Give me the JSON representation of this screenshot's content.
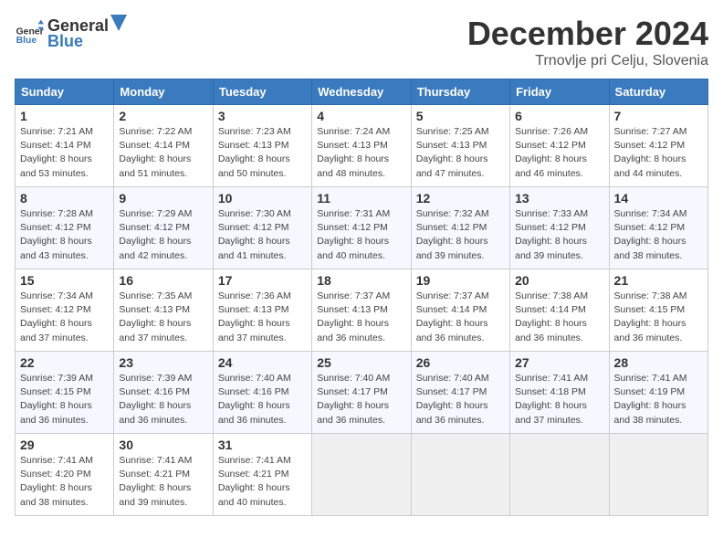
{
  "header": {
    "logo_general": "General",
    "logo_blue": "Blue",
    "month_title": "December 2024",
    "location": "Trnovlje pri Celju, Slovenia"
  },
  "calendar": {
    "days_of_week": [
      "Sunday",
      "Monday",
      "Tuesday",
      "Wednesday",
      "Thursday",
      "Friday",
      "Saturday"
    ],
    "weeks": [
      [
        null,
        {
          "day": "2",
          "sunrise": "7:22 AM",
          "sunset": "4:14 PM",
          "daylight": "8 hours and 51 minutes."
        },
        {
          "day": "3",
          "sunrise": "7:23 AM",
          "sunset": "4:13 PM",
          "daylight": "8 hours and 50 minutes."
        },
        {
          "day": "4",
          "sunrise": "7:24 AM",
          "sunset": "4:13 PM",
          "daylight": "8 hours and 48 minutes."
        },
        {
          "day": "5",
          "sunrise": "7:25 AM",
          "sunset": "4:13 PM",
          "daylight": "8 hours and 47 minutes."
        },
        {
          "day": "6",
          "sunrise": "7:26 AM",
          "sunset": "4:12 PM",
          "daylight": "8 hours and 46 minutes."
        },
        {
          "day": "7",
          "sunrise": "7:27 AM",
          "sunset": "4:12 PM",
          "daylight": "8 hours and 44 minutes."
        }
      ],
      [
        {
          "day": "1",
          "sunrise": "7:21 AM",
          "sunset": "4:14 PM",
          "daylight": "8 hours and 53 minutes."
        },
        {
          "day": "9",
          "sunrise": "7:29 AM",
          "sunset": "4:12 PM",
          "daylight": "8 hours and 42 minutes."
        },
        {
          "day": "10",
          "sunrise": "7:30 AM",
          "sunset": "4:12 PM",
          "daylight": "8 hours and 41 minutes."
        },
        {
          "day": "11",
          "sunrise": "7:31 AM",
          "sunset": "4:12 PM",
          "daylight": "8 hours and 40 minutes."
        },
        {
          "day": "12",
          "sunrise": "7:32 AM",
          "sunset": "4:12 PM",
          "daylight": "8 hours and 39 minutes."
        },
        {
          "day": "13",
          "sunrise": "7:33 AM",
          "sunset": "4:12 PM",
          "daylight": "8 hours and 39 minutes."
        },
        {
          "day": "14",
          "sunrise": "7:34 AM",
          "sunset": "4:12 PM",
          "daylight": "8 hours and 38 minutes."
        }
      ],
      [
        {
          "day": "8",
          "sunrise": "7:28 AM",
          "sunset": "4:12 PM",
          "daylight": "8 hours and 43 minutes."
        },
        {
          "day": "16",
          "sunrise": "7:35 AM",
          "sunset": "4:13 PM",
          "daylight": "8 hours and 37 minutes."
        },
        {
          "day": "17",
          "sunrise": "7:36 AM",
          "sunset": "4:13 PM",
          "daylight": "8 hours and 37 minutes."
        },
        {
          "day": "18",
          "sunrise": "7:37 AM",
          "sunset": "4:13 PM",
          "daylight": "8 hours and 36 minutes."
        },
        {
          "day": "19",
          "sunrise": "7:37 AM",
          "sunset": "4:14 PM",
          "daylight": "8 hours and 36 minutes."
        },
        {
          "day": "20",
          "sunrise": "7:38 AM",
          "sunset": "4:14 PM",
          "daylight": "8 hours and 36 minutes."
        },
        {
          "day": "21",
          "sunrise": "7:38 AM",
          "sunset": "4:15 PM",
          "daylight": "8 hours and 36 minutes."
        }
      ],
      [
        {
          "day": "15",
          "sunrise": "7:34 AM",
          "sunset": "4:12 PM",
          "daylight": "8 hours and 37 minutes."
        },
        {
          "day": "23",
          "sunrise": "7:39 AM",
          "sunset": "4:16 PM",
          "daylight": "8 hours and 36 minutes."
        },
        {
          "day": "24",
          "sunrise": "7:40 AM",
          "sunset": "4:16 PM",
          "daylight": "8 hours and 36 minutes."
        },
        {
          "day": "25",
          "sunrise": "7:40 AM",
          "sunset": "4:17 PM",
          "daylight": "8 hours and 36 minutes."
        },
        {
          "day": "26",
          "sunrise": "7:40 AM",
          "sunset": "4:17 PM",
          "daylight": "8 hours and 36 minutes."
        },
        {
          "day": "27",
          "sunrise": "7:41 AM",
          "sunset": "4:18 PM",
          "daylight": "8 hours and 37 minutes."
        },
        {
          "day": "28",
          "sunrise": "7:41 AM",
          "sunset": "4:19 PM",
          "daylight": "8 hours and 38 minutes."
        }
      ],
      [
        {
          "day": "22",
          "sunrise": "7:39 AM",
          "sunset": "4:15 PM",
          "daylight": "8 hours and 36 minutes."
        },
        {
          "day": "30",
          "sunrise": "7:41 AM",
          "sunset": "4:21 PM",
          "daylight": "8 hours and 39 minutes."
        },
        {
          "day": "31",
          "sunrise": "7:41 AM",
          "sunset": "4:21 PM",
          "daylight": "8 hours and 40 minutes."
        },
        null,
        null,
        null,
        null
      ],
      [
        {
          "day": "29",
          "sunrise": "7:41 AM",
          "sunset": "4:20 PM",
          "daylight": "8 hours and 38 minutes."
        },
        null,
        null,
        null,
        null,
        null,
        null
      ]
    ]
  }
}
